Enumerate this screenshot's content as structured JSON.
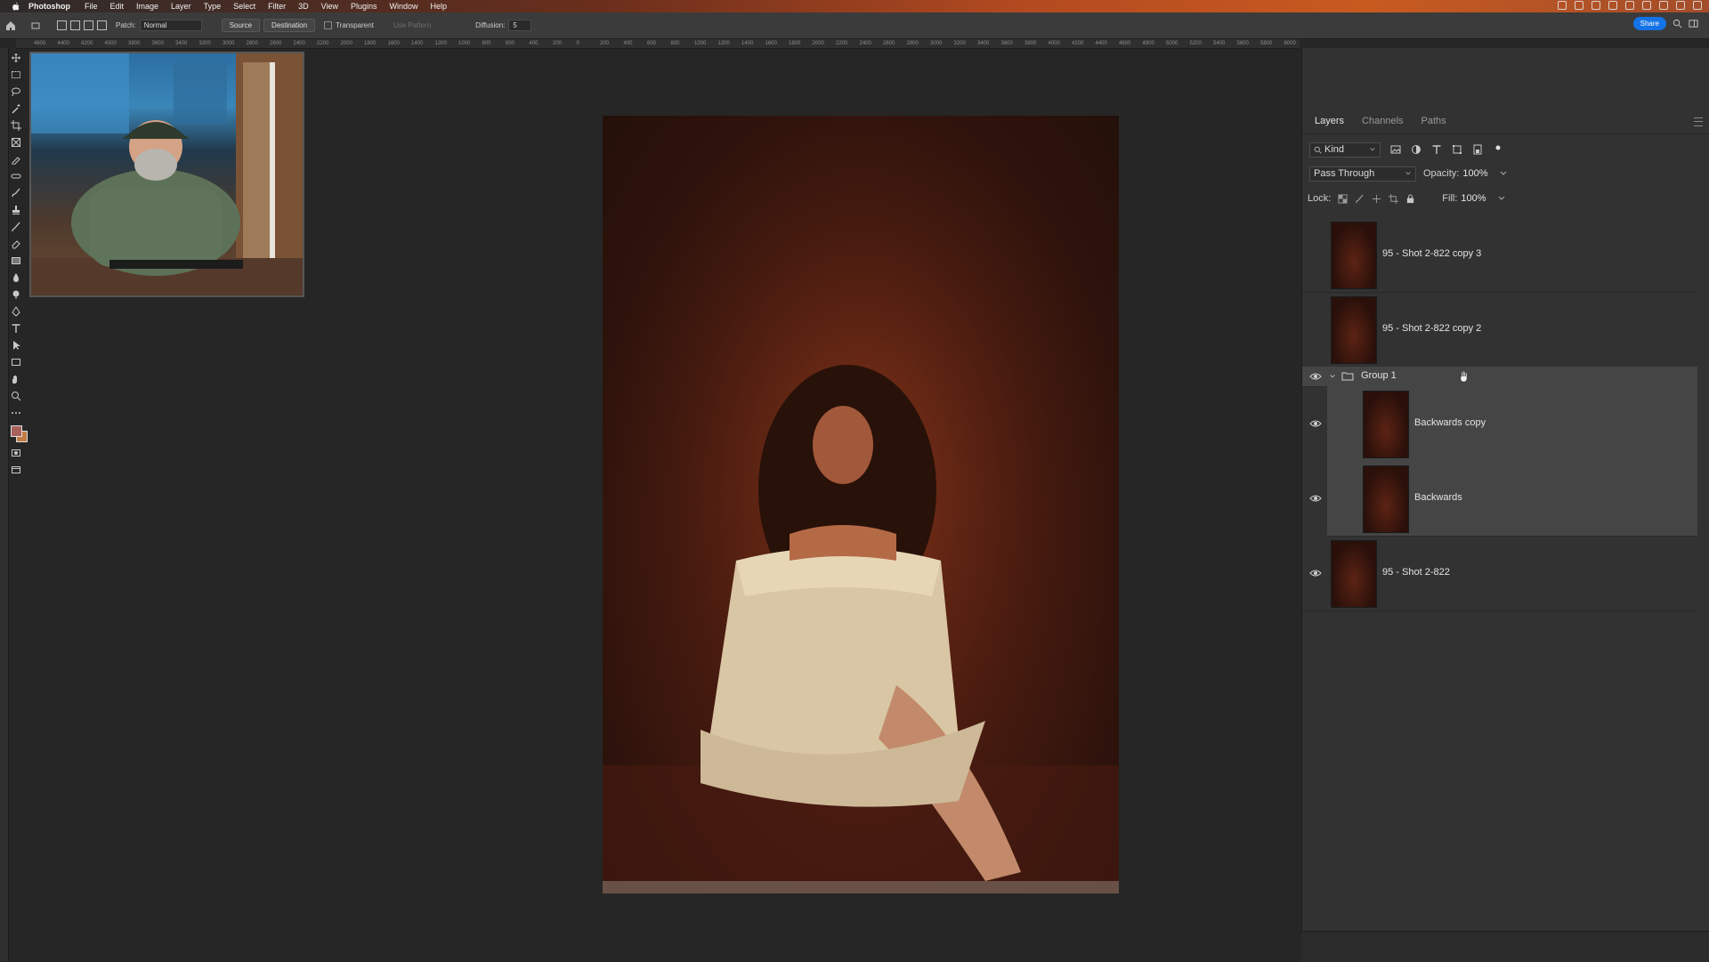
{
  "menubar": {
    "app_name": "Photoshop",
    "items": [
      "File",
      "Edit",
      "Image",
      "Layer",
      "Type",
      "Select",
      "Filter",
      "3D",
      "View",
      "Plugins",
      "Window",
      "Help"
    ]
  },
  "options_bar": {
    "patch_label": "Patch:",
    "patch_value": "Normal",
    "source_label": "Source",
    "destination_label": "Destination",
    "transparent_label": "Transparent",
    "use_pattern_label": "Use Pattern",
    "diffusion_label": "Diffusion:",
    "diffusion_value": "5",
    "share_label": "Share"
  },
  "ruler": {
    "ticks": [
      "4600",
      "4400",
      "4200",
      "4000",
      "3800",
      "3600",
      "3400",
      "3200",
      "3000",
      "2800",
      "2600",
      "2400",
      "2200",
      "2000",
      "1800",
      "1600",
      "1400",
      "1200",
      "1000",
      "800",
      "600",
      "400",
      "200",
      "0",
      "200",
      "400",
      "600",
      "800",
      "1000",
      "1200",
      "1400",
      "1600",
      "1800",
      "2000",
      "2200",
      "2400",
      "2600",
      "2800",
      "3000",
      "3200",
      "3400",
      "3600",
      "3800",
      "4000",
      "4200",
      "4400",
      "4600",
      "4800",
      "5000",
      "5200",
      "5400",
      "5600",
      "5800",
      "6000",
      "6200"
    ]
  },
  "layers_panel": {
    "tabs": [
      "Layers",
      "Channels",
      "Paths"
    ],
    "active_tab": "Layers",
    "kind_label": "Kind",
    "blend_mode": "Pass Through",
    "opacity_label": "Opacity:",
    "opacity_value": "100%",
    "lock_label": "Lock:",
    "fill_label": "Fill:",
    "fill_value": "100%",
    "group_name": "Group 1",
    "layers": [
      {
        "name": "95 - Shot 2-822 copy 3",
        "visible": false
      },
      {
        "name": "95 - Shot 2-822 copy 2",
        "visible": false
      },
      {
        "name": "Backwards copy",
        "visible": true
      },
      {
        "name": "Backwards",
        "visible": true
      },
      {
        "name": "95 - Shot 2-822",
        "visible": true
      }
    ]
  },
  "colors": {
    "accent": "#1473e6",
    "foreground_swatch": "#a8625a",
    "background_swatch": "#c27b44"
  },
  "icons": [
    "apple-icon",
    "home-icon",
    "patch-tool-icon",
    "search-icon",
    "eye-icon",
    "folder-icon",
    "lock-icon",
    "chevron-down-icon"
  ]
}
